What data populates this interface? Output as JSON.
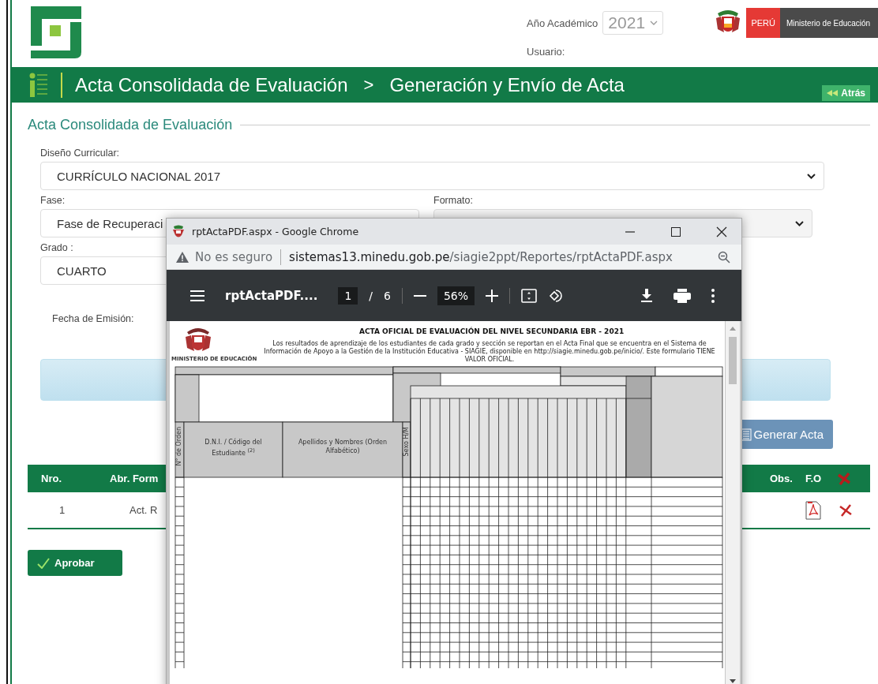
{
  "header": {
    "academic_year_label": "Año Académico",
    "academic_year": "2021",
    "user_label": "Usuario:",
    "brand": {
      "country": "PERÚ",
      "ministry": "Ministerio de Educación"
    }
  },
  "breadcrumb": {
    "items": [
      "Acta Consolidada de Evaluación",
      "Generación y Envío de Acta"
    ],
    "separator": ">"
  },
  "back_button": "Atrás",
  "section_title": "Acta Consolidada de Evaluación",
  "form": {
    "curriculum": {
      "label": "Diseño Curricular:",
      "value": "CURRÍCULO NACIONAL 2017"
    },
    "phase": {
      "label": "Fase:",
      "value": "Fase de Recuperaci"
    },
    "format": {
      "label": "Formato:"
    },
    "grade": {
      "label": "Grado :",
      "value": "CUARTO"
    },
    "issue_date": {
      "label": "Fecha de Emisión:"
    }
  },
  "generate_button": "Generar Acta",
  "table": {
    "columns": [
      "Nro.",
      "Abr. Form",
      "Obs.",
      "F.O"
    ],
    "rows": [
      {
        "cells": [
          "1",
          "Act. R"
        ]
      }
    ]
  },
  "approve_button": "Aprobar",
  "popup": {
    "title": "rptActaPDF.aspx - Google Chrome",
    "security": "No es seguro",
    "url_host": "sistemas13.minedu.gob.pe",
    "url_path": "/siagie2ppt/Reportes/rptActaPDF.aspx",
    "viewer": {
      "file": "rptActaPDF....",
      "page": "1",
      "of": "/",
      "total": "6",
      "zoom": "56%"
    },
    "document": {
      "org": "MINISTERIO DE EDUCACIÓN",
      "title": "ACTA OFICIAL DE EVALUACIÓN DEL NIVEL SECUNDARIA EBR - 2021",
      "intro": "Los resultados de aprendizaje de los estudiantes de cada grado y sección se reportan en el Acta Final que se encuentra en el Sistema de Información de Apoyo a la Gestión de la Institución Educativa - SIAGIE, disponible en http://siagie.minedu.gob.pe/inicio/. Este formulario TIENE VALOR OFICIAL.",
      "order_header": "N° de Orden",
      "id_header": "D.N.I. / Código del Estudiante $^{(2)}$",
      "name_header": "Apellidos y Nombres (Orden Alfabético)",
      "sex_header": "Sexo H/M"
    }
  }
}
